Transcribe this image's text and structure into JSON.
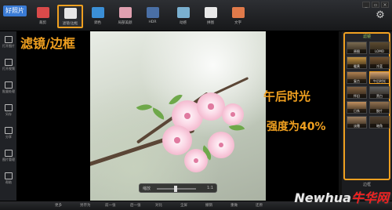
{
  "app": {
    "logo": "好照片"
  },
  "window_controls": [
    "_",
    "▫",
    "×"
  ],
  "toolbar": [
    {
      "label": "裁剪",
      "icon": "crop-icon",
      "color": "#d94a4a"
    },
    {
      "label": "滤镜/边框",
      "icon": "filter-icon",
      "color": "#e6e6e6",
      "active": true
    },
    {
      "label": "调色",
      "icon": "drop-icon",
      "color": "#3b8fd6"
    },
    {
      "label": "局部美颜",
      "icon": "brush-icon",
      "color": "#e0a0b0"
    },
    {
      "label": "HDR",
      "icon": "hdr-icon",
      "color": "#4a6fa5"
    },
    {
      "label": "动感",
      "icon": "motion-icon",
      "color": "#7ab0d0"
    },
    {
      "label": "拼图",
      "icon": "collage-icon",
      "color": "#e8e8e8"
    },
    {
      "label": "文字",
      "icon": "text-icon",
      "color": "#e07a4a"
    }
  ],
  "sidebar": [
    {
      "label": "打开图片",
      "icon": "folder-icon"
    },
    {
      "label": "打开视频",
      "icon": "video-icon"
    },
    {
      "label": "批量处理",
      "icon": "batch-icon"
    },
    {
      "label": "另存",
      "icon": "save-icon"
    },
    {
      "label": "分享",
      "icon": "share-icon"
    },
    {
      "label": "图片管理",
      "icon": "manage-icon"
    },
    {
      "label": "帮助",
      "icon": "help-icon"
    }
  ],
  "annotations": {
    "title": "滤镜/边框",
    "effect": "午后时光",
    "strength": "强度为40%"
  },
  "panel": {
    "header": "滤镜",
    "footer": "边框",
    "items": [
      {
        "label": "原图",
        "color": "#7a6a50"
      },
      {
        "label": "LOMO",
        "color": "#5a4a30"
      },
      {
        "label": "暖黄",
        "color": "#c09040"
      },
      {
        "label": "冷蓝",
        "color": "#705030"
      },
      {
        "label": "复古",
        "color": "#b08050"
      },
      {
        "label": "午后时光",
        "color": "#d0a070",
        "selected": true
      },
      {
        "label": "怀旧",
        "color": "#806040"
      },
      {
        "label": "黑白",
        "color": "#606060"
      },
      {
        "label": "日系",
        "color": "#c09060"
      },
      {
        "label": "胶片",
        "color": "#907050"
      },
      {
        "label": "淡雅",
        "color": "#a08060"
      },
      {
        "label": "暗角",
        "color": "#504030"
      }
    ]
  },
  "zoombar": {
    "left": "缩放",
    "right": "1:1"
  },
  "bottombar": {
    "items": [
      "更多",
      "另存为",
      "前一张",
      "后一张",
      "对比",
      "全屏",
      "撤销",
      "重做",
      "还原"
    ]
  },
  "watermark": {
    "brand": "Newhua",
    "suffix": "牛华网"
  },
  "colors": {
    "accent": "#f0a020",
    "panel_header": "#9ed06a"
  }
}
